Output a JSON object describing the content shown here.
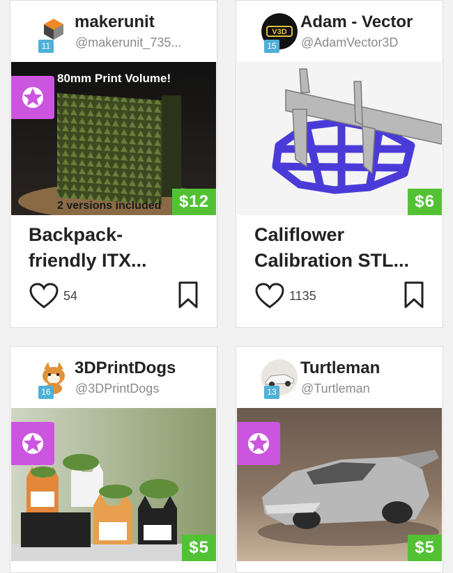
{
  "cards": [
    {
      "author": "makerunit",
      "handle": "@makerunit_735...",
      "level": "11",
      "avatar_icon": "cube-logo-icon",
      "featured": true,
      "image_overlay_top": "80mm Print Volume!",
      "image_overlay_bottom": "2 versions included",
      "price": "$12",
      "title_line1": "Backpack-",
      "title_line2": "friendly ITX...",
      "likes": "54"
    },
    {
      "author": "Adam - Vector",
      "handle": "@AdamVector3D",
      "level": "15",
      "avatar_text": "V3D",
      "avatar_icon": "v3d-logo-icon",
      "featured": false,
      "price": "$6",
      "title_line1": "Califlower",
      "title_line2": "Calibration STL...",
      "likes": "1135"
    },
    {
      "author": "3DPrintDogs",
      "handle": "@3DPrintDogs",
      "level": "16",
      "avatar_icon": "shiba-dog-icon",
      "featured": true,
      "price": "$5"
    },
    {
      "author": "Turtleman",
      "handle": "@Turtleman",
      "level": "13",
      "avatar_icon": "car-avatar-icon",
      "featured": true,
      "price": "$5"
    }
  ],
  "colors": {
    "featured": "#cc55e0",
    "price": "#52c234",
    "level_badge": "#4fb0d8",
    "model_purple": "#4a3bd8"
  },
  "icons": {
    "like": "heart-outline-icon",
    "bookmark": "bookmark-outline-icon",
    "featured": "star-badge-icon"
  }
}
